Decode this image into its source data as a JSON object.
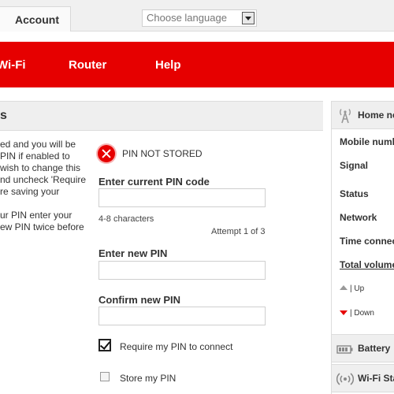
{
  "topbar": {
    "account_tab": "Account",
    "language_placeholder": "Choose language"
  },
  "nav": {
    "items": [
      "Wi-Fi",
      "Router",
      "Help"
    ]
  },
  "main": {
    "title": "s",
    "side_text": [
      "ed and you will be\nPIN if enabled to\n wish to change this\nnd uncheck 'Require\nre saving your",
      "ur PIN enter your\new PIN twice before"
    ],
    "status": "PIN NOT STORED",
    "current_pin_label": "Enter current PIN code",
    "hint": "4-8 characters",
    "attempt": "Attempt 1 of 3",
    "new_pin_label": "Enter new PIN",
    "confirm_pin_label": "Confirm new PIN",
    "require_pin_label": "Require my PIN to connect",
    "store_pin_label": "Store my PIN"
  },
  "right_panel": {
    "home_network_title": "Home ne",
    "mobile_number": "Mobile numb",
    "signal": "Signal",
    "status": "Status",
    "network": "Network",
    "time_connected": "Time connec",
    "total_volume": "Total volume",
    "up": "| Up",
    "down": "| Down",
    "battery_title": "Battery",
    "wifi_status_title": "Wi-Fi Sta"
  },
  "colors": {
    "brand_red": "#e60000",
    "panel_grey": "#efefef"
  }
}
